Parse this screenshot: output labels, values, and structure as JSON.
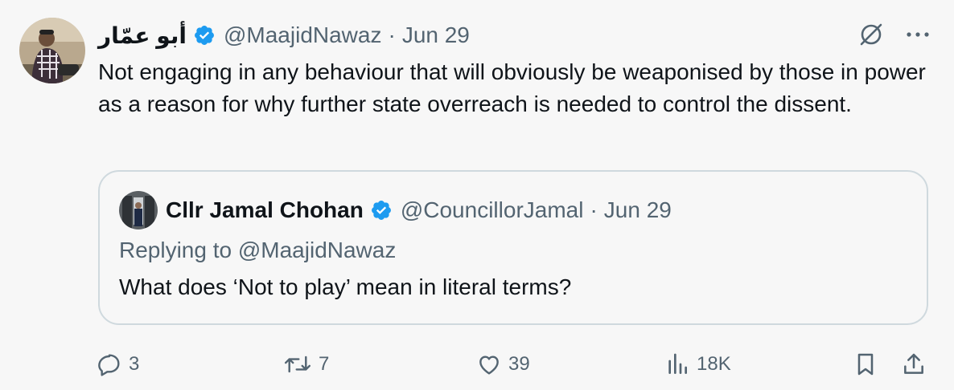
{
  "tweet": {
    "author_name": "أبو عمّار",
    "handle": "@MaajidNawaz",
    "separator": "·",
    "date": "Jun 29",
    "text": "Not engaging in any behaviour that will obviously be weaponised by those in power as a reason for why further state overreach is needed to control the dissent."
  },
  "quoted_tweet": {
    "author_name": "Cllr Jamal Chohan",
    "handle": "@CouncillorJamal",
    "separator": "·",
    "date": "Jun 29",
    "replying_to": "Replying to @MaajidNawaz",
    "text": "What does ‘Not to play’ mean in literal terms?"
  },
  "actions": {
    "reply_count": "3",
    "retweet_count": "7",
    "like_count": "39",
    "views_count": "18K"
  },
  "icons": {
    "verified": "verified-badge-icon",
    "grok": "grok-icon",
    "more": "more-icon",
    "reply": "reply-icon",
    "retweet": "retweet-icon",
    "like": "heart-icon",
    "views": "views-icon",
    "bookmark": "bookmark-icon",
    "share": "share-icon"
  },
  "colors": {
    "background": "#f7f7f7",
    "text": "#0f1419",
    "muted": "#536471",
    "verified": "#1d9bf0",
    "border": "#cfd9de"
  }
}
